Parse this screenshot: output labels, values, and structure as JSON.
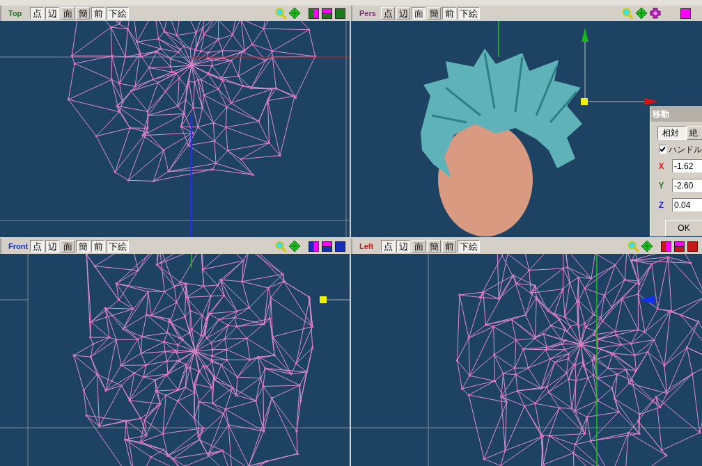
{
  "viewports": [
    {
      "kind": "top",
      "title": "Top",
      "color": "#1d7a1d",
      "buttons": [
        {
          "label": "点",
          "selected": true
        },
        {
          "label": "辺",
          "selected": true
        },
        {
          "label": "面",
          "selected": false
        },
        {
          "label": "簡",
          "selected": false
        },
        {
          "label": "前",
          "selected": true
        },
        {
          "label": "下絵",
          "selected": true
        }
      ]
    },
    {
      "kind": "pers",
      "title": "Pers",
      "color": "#862a86",
      "buttons": [
        {
          "label": "点",
          "selected": false
        },
        {
          "label": "辺",
          "selected": false
        },
        {
          "label": "面",
          "selected": true
        },
        {
          "label": "簡",
          "selected": false
        },
        {
          "label": "前",
          "selected": true
        },
        {
          "label": "下絵",
          "selected": true
        }
      ]
    },
    {
      "kind": "front",
      "title": "Front",
      "color": "#1530b5",
      "buttons": [
        {
          "label": "点",
          "selected": true
        },
        {
          "label": "辺",
          "selected": true
        },
        {
          "label": "面",
          "selected": false
        },
        {
          "label": "簡",
          "selected": true
        },
        {
          "label": "前",
          "selected": true
        },
        {
          "label": "下絵",
          "selected": true
        }
      ]
    },
    {
      "kind": "left",
      "title": "Left",
      "color": "#c41a1a",
      "buttons": [
        {
          "label": "点",
          "selected": true
        },
        {
          "label": "辺",
          "selected": true
        },
        {
          "label": "面",
          "selected": false
        },
        {
          "label": "簡",
          "selected": false
        },
        {
          "label": "前",
          "selected": false
        },
        {
          "label": "下絵",
          "selected": true
        }
      ]
    }
  ],
  "move_dialog": {
    "title": "移動",
    "tabs": [
      {
        "label": "相対",
        "selected": true
      },
      {
        "label": "絶",
        "selected": false
      }
    ],
    "handle": {
      "label": "ハンドル",
      "checked": true
    },
    "fields": [
      {
        "axis": "X",
        "value": "-1.62",
        "color": "#e02020"
      },
      {
        "axis": "Y",
        "value": "-2.60",
        "color": "#2a7a2a"
      },
      {
        "axis": "Z",
        "value": "0.04",
        "color": "#2020c0"
      }
    ],
    "ok_button": "OK"
  }
}
